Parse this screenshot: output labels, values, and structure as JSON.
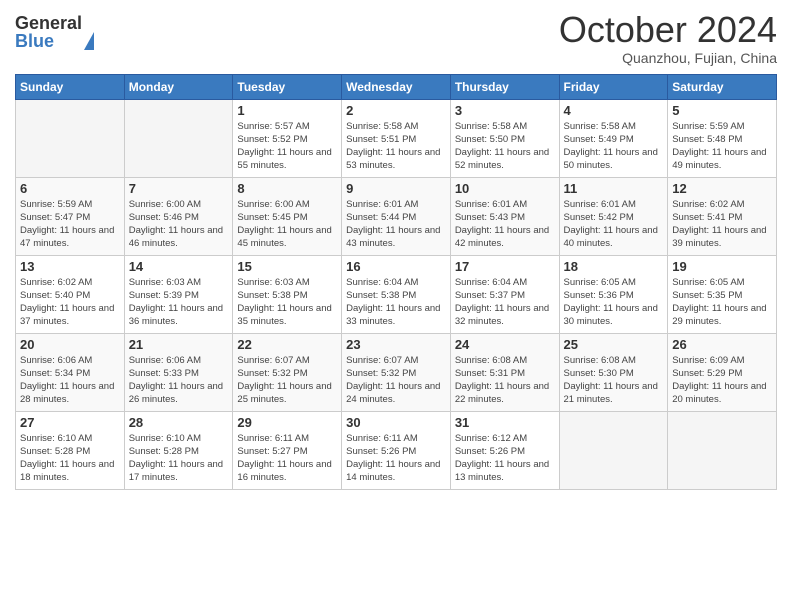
{
  "header": {
    "logo_general": "General",
    "logo_blue": "Blue",
    "month_title": "October 2024",
    "location": "Quanzhou, Fujian, China"
  },
  "days_of_week": [
    "Sunday",
    "Monday",
    "Tuesday",
    "Wednesday",
    "Thursday",
    "Friday",
    "Saturday"
  ],
  "weeks": [
    [
      {
        "day": "",
        "sunrise": "",
        "sunset": "",
        "daylight": ""
      },
      {
        "day": "",
        "sunrise": "",
        "sunset": "",
        "daylight": ""
      },
      {
        "day": "1",
        "sunrise": "Sunrise: 5:57 AM",
        "sunset": "Sunset: 5:52 PM",
        "daylight": "Daylight: 11 hours and 55 minutes."
      },
      {
        "day": "2",
        "sunrise": "Sunrise: 5:58 AM",
        "sunset": "Sunset: 5:51 PM",
        "daylight": "Daylight: 11 hours and 53 minutes."
      },
      {
        "day": "3",
        "sunrise": "Sunrise: 5:58 AM",
        "sunset": "Sunset: 5:50 PM",
        "daylight": "Daylight: 11 hours and 52 minutes."
      },
      {
        "day": "4",
        "sunrise": "Sunrise: 5:58 AM",
        "sunset": "Sunset: 5:49 PM",
        "daylight": "Daylight: 11 hours and 50 minutes."
      },
      {
        "day": "5",
        "sunrise": "Sunrise: 5:59 AM",
        "sunset": "Sunset: 5:48 PM",
        "daylight": "Daylight: 11 hours and 49 minutes."
      }
    ],
    [
      {
        "day": "6",
        "sunrise": "Sunrise: 5:59 AM",
        "sunset": "Sunset: 5:47 PM",
        "daylight": "Daylight: 11 hours and 47 minutes."
      },
      {
        "day": "7",
        "sunrise": "Sunrise: 6:00 AM",
        "sunset": "Sunset: 5:46 PM",
        "daylight": "Daylight: 11 hours and 46 minutes."
      },
      {
        "day": "8",
        "sunrise": "Sunrise: 6:00 AM",
        "sunset": "Sunset: 5:45 PM",
        "daylight": "Daylight: 11 hours and 45 minutes."
      },
      {
        "day": "9",
        "sunrise": "Sunrise: 6:01 AM",
        "sunset": "Sunset: 5:44 PM",
        "daylight": "Daylight: 11 hours and 43 minutes."
      },
      {
        "day": "10",
        "sunrise": "Sunrise: 6:01 AM",
        "sunset": "Sunset: 5:43 PM",
        "daylight": "Daylight: 11 hours and 42 minutes."
      },
      {
        "day": "11",
        "sunrise": "Sunrise: 6:01 AM",
        "sunset": "Sunset: 5:42 PM",
        "daylight": "Daylight: 11 hours and 40 minutes."
      },
      {
        "day": "12",
        "sunrise": "Sunrise: 6:02 AM",
        "sunset": "Sunset: 5:41 PM",
        "daylight": "Daylight: 11 hours and 39 minutes."
      }
    ],
    [
      {
        "day": "13",
        "sunrise": "Sunrise: 6:02 AM",
        "sunset": "Sunset: 5:40 PM",
        "daylight": "Daylight: 11 hours and 37 minutes."
      },
      {
        "day": "14",
        "sunrise": "Sunrise: 6:03 AM",
        "sunset": "Sunset: 5:39 PM",
        "daylight": "Daylight: 11 hours and 36 minutes."
      },
      {
        "day": "15",
        "sunrise": "Sunrise: 6:03 AM",
        "sunset": "Sunset: 5:38 PM",
        "daylight": "Daylight: 11 hours and 35 minutes."
      },
      {
        "day": "16",
        "sunrise": "Sunrise: 6:04 AM",
        "sunset": "Sunset: 5:38 PM",
        "daylight": "Daylight: 11 hours and 33 minutes."
      },
      {
        "day": "17",
        "sunrise": "Sunrise: 6:04 AM",
        "sunset": "Sunset: 5:37 PM",
        "daylight": "Daylight: 11 hours and 32 minutes."
      },
      {
        "day": "18",
        "sunrise": "Sunrise: 6:05 AM",
        "sunset": "Sunset: 5:36 PM",
        "daylight": "Daylight: 11 hours and 30 minutes."
      },
      {
        "day": "19",
        "sunrise": "Sunrise: 6:05 AM",
        "sunset": "Sunset: 5:35 PM",
        "daylight": "Daylight: 11 hours and 29 minutes."
      }
    ],
    [
      {
        "day": "20",
        "sunrise": "Sunrise: 6:06 AM",
        "sunset": "Sunset: 5:34 PM",
        "daylight": "Daylight: 11 hours and 28 minutes."
      },
      {
        "day": "21",
        "sunrise": "Sunrise: 6:06 AM",
        "sunset": "Sunset: 5:33 PM",
        "daylight": "Daylight: 11 hours and 26 minutes."
      },
      {
        "day": "22",
        "sunrise": "Sunrise: 6:07 AM",
        "sunset": "Sunset: 5:32 PM",
        "daylight": "Daylight: 11 hours and 25 minutes."
      },
      {
        "day": "23",
        "sunrise": "Sunrise: 6:07 AM",
        "sunset": "Sunset: 5:32 PM",
        "daylight": "Daylight: 11 hours and 24 minutes."
      },
      {
        "day": "24",
        "sunrise": "Sunrise: 6:08 AM",
        "sunset": "Sunset: 5:31 PM",
        "daylight": "Daylight: 11 hours and 22 minutes."
      },
      {
        "day": "25",
        "sunrise": "Sunrise: 6:08 AM",
        "sunset": "Sunset: 5:30 PM",
        "daylight": "Daylight: 11 hours and 21 minutes."
      },
      {
        "day": "26",
        "sunrise": "Sunrise: 6:09 AM",
        "sunset": "Sunset: 5:29 PM",
        "daylight": "Daylight: 11 hours and 20 minutes."
      }
    ],
    [
      {
        "day": "27",
        "sunrise": "Sunrise: 6:10 AM",
        "sunset": "Sunset: 5:28 PM",
        "daylight": "Daylight: 11 hours and 18 minutes."
      },
      {
        "day": "28",
        "sunrise": "Sunrise: 6:10 AM",
        "sunset": "Sunset: 5:28 PM",
        "daylight": "Daylight: 11 hours and 17 minutes."
      },
      {
        "day": "29",
        "sunrise": "Sunrise: 6:11 AM",
        "sunset": "Sunset: 5:27 PM",
        "daylight": "Daylight: 11 hours and 16 minutes."
      },
      {
        "day": "30",
        "sunrise": "Sunrise: 6:11 AM",
        "sunset": "Sunset: 5:26 PM",
        "daylight": "Daylight: 11 hours and 14 minutes."
      },
      {
        "day": "31",
        "sunrise": "Sunrise: 6:12 AM",
        "sunset": "Sunset: 5:26 PM",
        "daylight": "Daylight: 11 hours and 13 minutes."
      },
      {
        "day": "",
        "sunrise": "",
        "sunset": "",
        "daylight": ""
      },
      {
        "day": "",
        "sunrise": "",
        "sunset": "",
        "daylight": ""
      }
    ]
  ]
}
